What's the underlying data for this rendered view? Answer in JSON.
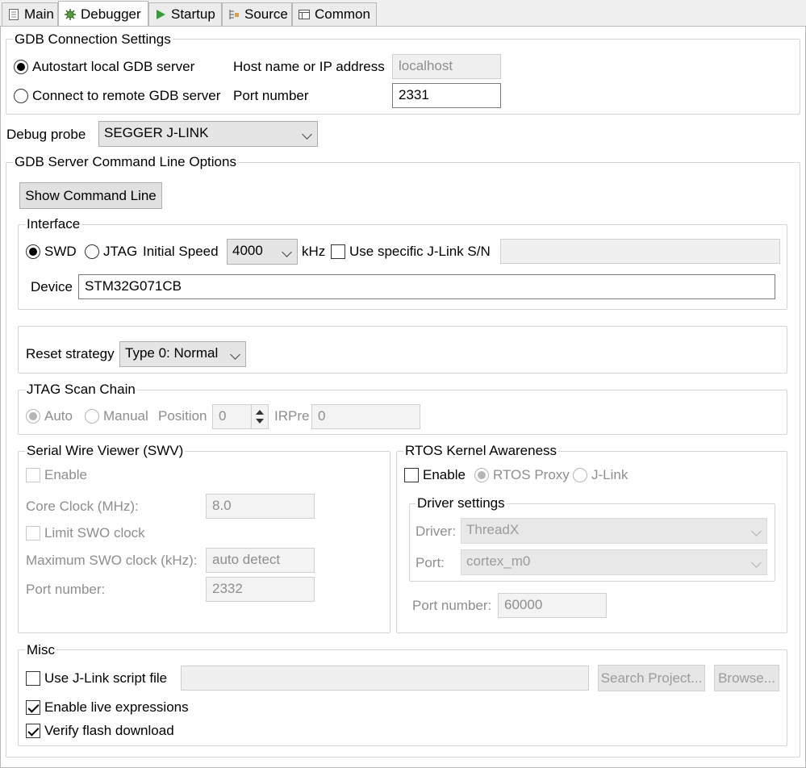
{
  "tabs": [
    {
      "label": "Main",
      "icon": "document-icon"
    },
    {
      "label": "Debugger",
      "icon": "bug-gear-icon"
    },
    {
      "label": "Startup",
      "icon": "play-icon"
    },
    {
      "label": "Source",
      "icon": "source-icon"
    },
    {
      "label": "Common",
      "icon": "window-icon"
    }
  ],
  "gdb": {
    "title": "GDB Connection Settings",
    "autostart": "Autostart local GDB server",
    "remote": "Connect to remote GDB server",
    "host_label": "Host name or IP address",
    "host_value": "localhost",
    "port_label": "Port number",
    "port_value": "2331"
  },
  "probe": {
    "label": "Debug probe",
    "value": "SEGGER J-LINK"
  },
  "server": {
    "title": "GDB Server Command Line Options",
    "show_cmd": "Show Command Line"
  },
  "interface": {
    "title": "Interface",
    "swd": "SWD",
    "jtag": "JTAG",
    "speed_label": "Initial Speed",
    "speed_value": "4000",
    "khz": "kHz",
    "sn_label": "Use specific J-Link S/N",
    "sn_value": "",
    "device_label": "Device",
    "device_value": "STM32G071CB"
  },
  "reset": {
    "label": "Reset strategy",
    "value": "Type 0: Normal"
  },
  "jtag_chain": {
    "title": "JTAG Scan Chain",
    "auto": "Auto",
    "manual": "Manual",
    "position_label": "Position",
    "position_value": "0",
    "irpre_label": "IRPre",
    "irpre_value": "0"
  },
  "swv": {
    "title": "Serial Wire Viewer (SWV)",
    "enable": "Enable",
    "core_clock_label": "Core Clock (MHz):",
    "core_clock_value": "8.0",
    "limit": "Limit SWO clock",
    "max_label": "Maximum SWO clock (kHz):",
    "max_value": "auto detect",
    "port_label": "Port number:",
    "port_value": "2332"
  },
  "rtos": {
    "title": "RTOS Kernel Awareness",
    "enable": "Enable",
    "proxy": "RTOS Proxy",
    "jlink": "J-Link",
    "driver_title": "Driver settings",
    "driver_label": "Driver:",
    "driver_value": "ThreadX",
    "port_label": "Port:",
    "port_value": "cortex_m0",
    "portnum_label": "Port number:",
    "portnum_value": "60000"
  },
  "misc": {
    "title": "Misc",
    "script": "Use J-Link script file",
    "script_value": "",
    "search": "Search Project...",
    "browse": "Browse...",
    "live": "Enable live expressions",
    "verify": "Verify flash download"
  }
}
